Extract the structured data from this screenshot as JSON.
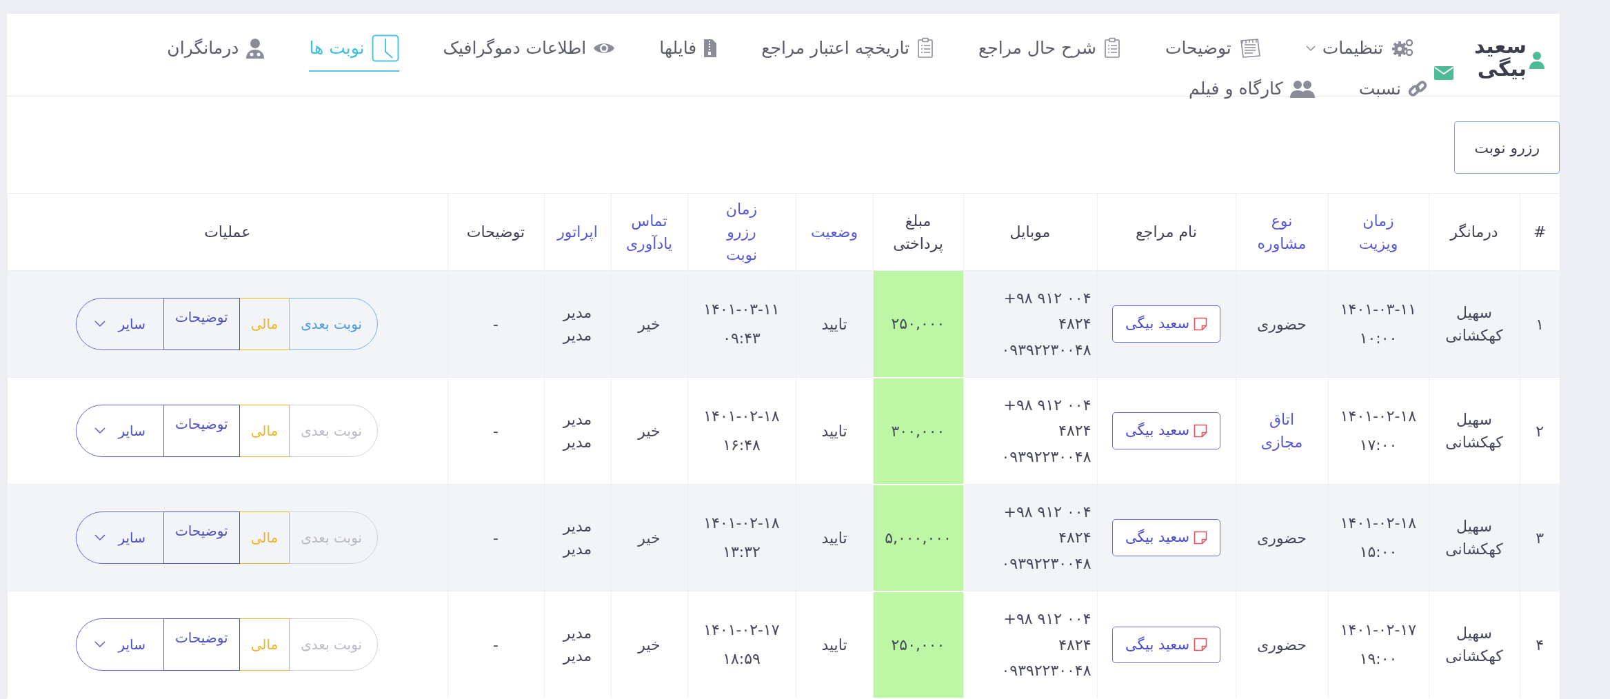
{
  "user": {
    "name": "سعید بیگی"
  },
  "nav": {
    "rows": [
      {
        "items": [
          {
            "label": "تنظیمات",
            "dropdown": true,
            "selected": false
          },
          {
            "label": "توضیحات",
            "dropdown": false,
            "selected": false
          },
          {
            "label": "شرح حال مراجع",
            "dropdown": false,
            "selected": false
          },
          {
            "label": "تاریخچه اعتبار مراجع",
            "dropdown": false,
            "selected": false
          },
          {
            "label": "فایلها",
            "dropdown": false,
            "selected": false
          },
          {
            "label": "اطلاعات دموگرافیک",
            "dropdown": false,
            "selected": false
          },
          {
            "label": "نوبت ها",
            "dropdown": false,
            "selected": true
          },
          {
            "label": "درمانگران",
            "dropdown": false,
            "selected": false
          }
        ]
      },
      {
        "items": [
          {
            "label": "نسبت",
            "dropdown": false,
            "selected": false
          },
          {
            "label": "کارگاه و فیلم",
            "dropdown": false,
            "selected": false
          }
        ]
      }
    ]
  },
  "reserve_button": "رزرو نوبت",
  "table": {
    "columns": [
      {
        "label": "#",
        "link": false
      },
      {
        "label": "درمانگر",
        "link": false
      },
      {
        "label": "زمان ویزیت",
        "link": true
      },
      {
        "label": "نوع مشاوره",
        "link": true
      },
      {
        "label": "نام مراجع",
        "link": false
      },
      {
        "label": "موبایل",
        "link": false
      },
      {
        "label": "مبلغ پرداختی",
        "link": false
      },
      {
        "label": "وضعیت",
        "link": true
      },
      {
        "label": "زمان رزرو نوبت",
        "link": true
      },
      {
        "label": "تماس یادآوری",
        "link": true
      },
      {
        "label": "اپراتور",
        "link": true
      },
      {
        "label": "توضیحات",
        "link": false
      },
      {
        "label": "عملیات",
        "link": false
      }
    ],
    "rows": [
      {
        "number": "۱",
        "therapist": "سهیل کهکشانی",
        "visit_date": "۱۴۰۱-۰۳-۱۱",
        "visit_time": "۱۰:۰۰",
        "consultation": {
          "label": "حضوری",
          "link": false
        },
        "client": "سعید بیگی",
        "phone": "+۹۸ ۹۱۲ ۰۰۴ ۴۸۲۴",
        "mobile": "۰۹۳۹۲۲۳۰۰۴۸",
        "amount": "۲۵۰,۰۰۰",
        "status": "تایید",
        "booked_date": "۱۴۰۱-۰۳-۱۱",
        "booked_time": "۰۹:۴۳",
        "reminder": "خیر",
        "operator": "مدیر مدیر",
        "notes": "-",
        "actions": [
          {
            "label": "نوبت بعدی",
            "kind": "next",
            "disabled": false
          },
          {
            "label": "مالی",
            "kind": "finance",
            "disabled": false
          },
          {
            "label": "توضیحات",
            "kind": "notes",
            "disabled": false
          },
          {
            "label": "سایر",
            "kind": "more",
            "disabled": false
          }
        ]
      },
      {
        "number": "۲",
        "therapist": "سهیل کهکشانی",
        "visit_date": "۱۴۰۱-۰۲-۱۸",
        "visit_time": "۱۷:۰۰",
        "consultation": {
          "label": "اتاق مجازی",
          "link": true
        },
        "client": "سعید بیگی",
        "phone": "+۹۸ ۹۱۲ ۰۰۴ ۴۸۲۴",
        "mobile": "۰۹۳۹۲۲۳۰۰۴۸",
        "amount": "۳۰۰,۰۰۰",
        "status": "تایید",
        "booked_date": "۱۴۰۱-۰۲-۱۸",
        "booked_time": "۱۶:۴۸",
        "reminder": "خیر",
        "operator": "مدیر مدیر",
        "notes": "-",
        "actions": [
          {
            "label": "نوبت بعدی",
            "kind": "next",
            "disabled": true
          },
          {
            "label": "مالی",
            "kind": "finance",
            "disabled": false
          },
          {
            "label": "توضیحات",
            "kind": "notes",
            "disabled": false
          },
          {
            "label": "سایر",
            "kind": "more",
            "disabled": false
          }
        ]
      },
      {
        "number": "۳",
        "therapist": "سهیل کهکشانی",
        "visit_date": "۱۴۰۱-۰۲-۱۸",
        "visit_time": "۱۵:۰۰",
        "consultation": {
          "label": "حضوری",
          "link": false
        },
        "client": "سعید بیگی",
        "phone": "+۹۸ ۹۱۲ ۰۰۴ ۴۸۲۴",
        "mobile": "۰۹۳۹۲۲۳۰۰۴۸",
        "amount": "۵,۰۰۰,۰۰۰",
        "status": "تایید",
        "booked_date": "۱۴۰۱-۰۲-۱۸",
        "booked_time": "۱۳:۳۲",
        "reminder": "خیر",
        "operator": "مدیر مدیر",
        "notes": "-",
        "actions": [
          {
            "label": "نوبت بعدی",
            "kind": "next",
            "disabled": true
          },
          {
            "label": "مالی",
            "kind": "finance",
            "disabled": false
          },
          {
            "label": "توضیحات",
            "kind": "notes",
            "disabled": false
          },
          {
            "label": "سایر",
            "kind": "more",
            "disabled": false
          }
        ]
      },
      {
        "number": "۴",
        "therapist": "سهیل کهکشانی",
        "visit_date": "۱۴۰۱-۰۲-۱۷",
        "visit_time": "۱۹:۰۰",
        "consultation": {
          "label": "حضوری",
          "link": false
        },
        "client": "سعید بیگی",
        "phone": "+۹۸ ۹۱۲ ۰۰۴ ۴۸۲۴",
        "mobile": "۰۹۳۹۲۲۳۰۰۴۸",
        "amount": "۲۵۰,۰۰۰",
        "status": "تایید",
        "booked_date": "۱۴۰۱-۰۲-۱۷",
        "booked_time": "۱۸:۵۹",
        "reminder": "خیر",
        "operator": "مدیر مدیر",
        "notes": "-",
        "actions": [
          {
            "label": "نوبت بعدی",
            "kind": "next",
            "disabled": true
          },
          {
            "label": "مالی",
            "kind": "finance",
            "disabled": false
          },
          {
            "label": "توضیحات",
            "kind": "notes",
            "disabled": false
          },
          {
            "label": "سایر",
            "kind": "more",
            "disabled": false
          }
        ]
      }
    ]
  }
}
